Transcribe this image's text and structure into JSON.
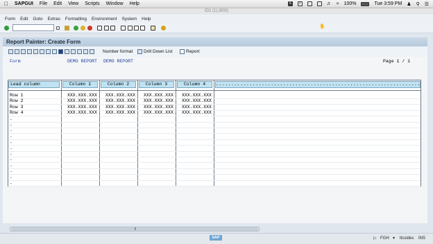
{
  "mac_menubar": {
    "app": "SAPGUI",
    "items": [
      "File",
      "Edit",
      "View",
      "Scripts",
      "Window",
      "Help"
    ],
    "battery": "100%",
    "clock": "Tue 3:59 PM"
  },
  "window": {
    "title": "ID1 (1) (800)"
  },
  "sap_menu": [
    "Form",
    "Edit",
    "Goto",
    "Extras",
    "Formatting",
    "Environment",
    "System",
    "Help"
  ],
  "command_field": {
    "value": ""
  },
  "screen": {
    "title": "Report Painter: Create Form",
    "toolbar": {
      "number_format": "Number format",
      "drill_down": "Drill Down List",
      "report": "Report"
    }
  },
  "form": {
    "label": "Form",
    "name1": "DEMO REPORT",
    "name2": "DEMO REPORT",
    "page": "Page  1  /  1"
  },
  "table": {
    "lead_header": "Lead column",
    "columns": [
      "Column 1",
      "Column 2",
      "Column 3",
      "Column 4"
    ],
    "rows": [
      "Row 1",
      "Row 2",
      "Row 3",
      "Row 4"
    ],
    "cell_value": "XXX.XXX.XXX",
    "empty_marker": ".",
    "dots": "..........................................................................."
  },
  "status": {
    "system": "FGH",
    "host": "ttcsides",
    "mode": "INS",
    "logo": "SAP"
  },
  "colors": {
    "title_band": "#c2d3e4",
    "header_cell": "#bfe3f2",
    "blue_text": "#1d3fa0"
  }
}
